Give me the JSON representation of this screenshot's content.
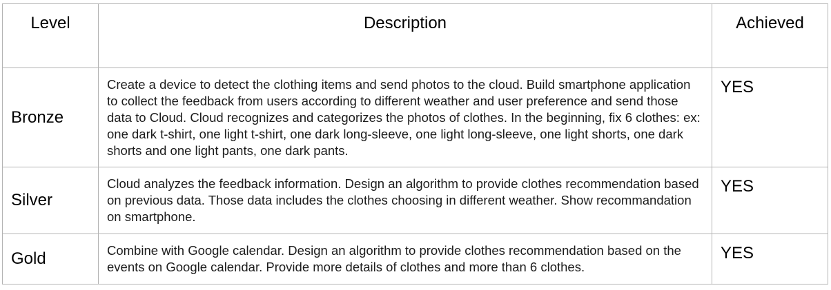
{
  "headers": {
    "level": "Level",
    "description": "Description",
    "achieved": "Achieved"
  },
  "rows": [
    {
      "level": "Bronze",
      "description": "Create a device to detect the clothing items and send photos to the cloud. Build smartphone application to collect the feedback from users according to different weather and user preference and send those data to Cloud. Cloud recognizes and categorizes the photos of clothes. In the beginning, fix 6 clothes: ex: one dark t-shirt, one light t-shirt, one dark long-sleeve, one light long-sleeve, one light shorts, one dark shorts and one light pants, one dark pants.",
      "achieved": "YES"
    },
    {
      "level": "Silver",
      "description": "Cloud analyzes the feedback information. Design an algorithm to provide clothes recommendation based on previous data. Those data includes the clothes choosing in different weather. Show recommandation on smartphone.",
      "achieved": "YES"
    },
    {
      "level": "Gold",
      "description": "Combine with Google calendar. Design an algorithm to provide clothes recommendation based on the events on Google calendar. Provide more details of clothes and more than 6 clothes.",
      "achieved": "YES"
    }
  ]
}
